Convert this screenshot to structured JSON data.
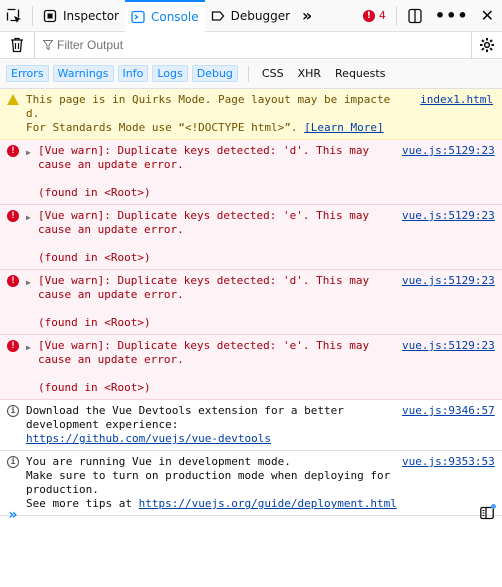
{
  "toolbar": {
    "tabs": [
      {
        "label": "Inspector"
      },
      {
        "label": "Console"
      },
      {
        "label": "Debugger"
      }
    ],
    "error_count": "4",
    "accent_color": "#0a84ff"
  },
  "filter": {
    "placeholder": "Filter Output"
  },
  "categories": {
    "levels": [
      "Errors",
      "Warnings",
      "Info",
      "Logs",
      "Debug"
    ],
    "types": [
      "CSS",
      "XHR",
      "Requests"
    ]
  },
  "messages": [
    {
      "kind": "warn",
      "text": "This page is in Quirks Mode. Page layout may be impacted.\nFor Standards Mode use “<!DOCTYPE html>”.",
      "link": "[Learn More]",
      "location": "index1.html"
    },
    {
      "kind": "err",
      "text": "[Vue warn]: Duplicate keys detected: 'd'. This may\ncause an update error.\n\n(found in <Root>)",
      "location": "vue.js:5129:23"
    },
    {
      "kind": "err",
      "text": "[Vue warn]: Duplicate keys detected: 'e'. This may\ncause an update error.\n\n(found in <Root>)",
      "location": "vue.js:5129:23"
    },
    {
      "kind": "err",
      "text": "[Vue warn]: Duplicate keys detected: 'd'. This may\ncause an update error.\n\n(found in <Root>)",
      "location": "vue.js:5129:23"
    },
    {
      "kind": "err",
      "text": "[Vue warn]: Duplicate keys detected: 'e'. This may\ncause an update error.\n\n(found in <Root>)",
      "location": "vue.js:5129:23"
    },
    {
      "kind": "info",
      "text": "Download the Vue Devtools extension for a better\ndevelopment experience:",
      "link": "https://github.com/vuejs/vue-devtools",
      "location": "vue.js:9346:57"
    },
    {
      "kind": "info",
      "text": "You are running Vue in development mode.\nMake sure to turn on production mode when deploying for\nproduction.\nSee more tips at",
      "link": "https://vuejs.org/guide/deployment.html",
      "location": "vue.js:9353:53"
    }
  ]
}
